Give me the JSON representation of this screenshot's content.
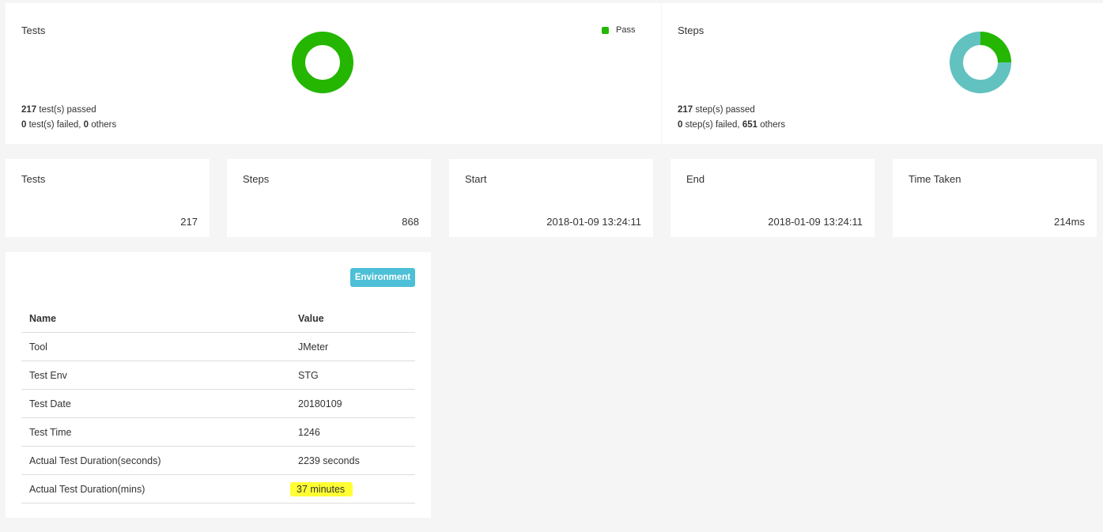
{
  "colors": {
    "pass": "#24b600",
    "others": "#62c2c0",
    "badge": "#4dbfd6",
    "highlight": "#ffff33"
  },
  "tests_card": {
    "title": "Tests",
    "legend_label": "Pass",
    "passed_count": "217",
    "passed_text": " test(s) passed",
    "failed_count": "0",
    "failed_text": " test(s) failed, ",
    "others_count": "0",
    "others_text": " others",
    "chart_data": {
      "type": "pie",
      "categories": [
        "Pass",
        "Fail",
        "Others"
      ],
      "values": [
        217,
        0,
        0
      ]
    }
  },
  "steps_card": {
    "title": "Steps",
    "passed_count": "217",
    "passed_text": " step(s) passed",
    "failed_count": "0",
    "failed_text": " step(s) failed, ",
    "others_count": "651",
    "others_text": " others",
    "chart_data": {
      "type": "pie",
      "categories": [
        "Pass",
        "Fail",
        "Others"
      ],
      "values": [
        217,
        0,
        651
      ]
    }
  },
  "stats": [
    {
      "label": "Tests",
      "value": "217"
    },
    {
      "label": "Steps",
      "value": "868"
    },
    {
      "label": "Start",
      "value": "2018-01-09 13:24:11"
    },
    {
      "label": "End",
      "value": "2018-01-09 13:24:11"
    },
    {
      "label": "Time Taken",
      "value": "214ms"
    }
  ],
  "environment": {
    "badge": "Environment",
    "headers": {
      "name": "Name",
      "value": "Value"
    },
    "rows": [
      {
        "name": "Tool",
        "value": "JMeter"
      },
      {
        "name": "Test Env",
        "value": "STG"
      },
      {
        "name": "Test Date",
        "value": "20180109"
      },
      {
        "name": "Test Time",
        "value": "1246"
      },
      {
        "name": "Actual Test Duration(seconds)",
        "value": "2239 seconds"
      },
      {
        "name": "Actual Test Duration(mins)",
        "value": "37 minutes"
      }
    ]
  }
}
